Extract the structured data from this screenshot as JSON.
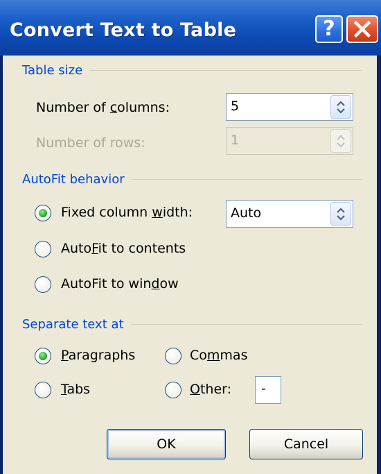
{
  "window": {
    "title": "Convert Text to Table",
    "help_glyph": "?"
  },
  "table_size": {
    "title": "Table size",
    "columns_label": {
      "pre": "Number of ",
      "ul": "c",
      "post": "olumns:"
    },
    "columns_value": "5",
    "rows_label": "Number of rows:",
    "rows_value": "1"
  },
  "autofit": {
    "title": "AutoFit behavior",
    "fixed": {
      "pre": "Fixed column ",
      "ul": "w",
      "post": "idth:",
      "selected": true
    },
    "fixed_value": "Auto",
    "contents": {
      "pre": "Auto",
      "ul": "F",
      "post": "it to contents",
      "selected": false
    },
    "window": {
      "pre": "AutoFit to win",
      "ul": "d",
      "post": "ow",
      "selected": false
    }
  },
  "separate": {
    "title": "Separate text at",
    "paragraphs": {
      "pre": "",
      "ul": "P",
      "post": "aragraphs",
      "selected": true
    },
    "commas": {
      "pre": "Co",
      "ul": "m",
      "post": "mas",
      "selected": false
    },
    "tabs": {
      "pre": "",
      "ul": "T",
      "post": "abs",
      "selected": false
    },
    "other": {
      "pre": "",
      "ul": "O",
      "post": "ther:",
      "selected": false
    },
    "other_value": "-"
  },
  "buttons": {
    "ok": "OK",
    "cancel": "Cancel"
  },
  "colors": {
    "title_bar": "#1b5ec6",
    "group_title": "#0046d5",
    "dialog_bg": "#ece9d8",
    "radio_selected": "#21a121",
    "close_button": "#e0502a"
  }
}
